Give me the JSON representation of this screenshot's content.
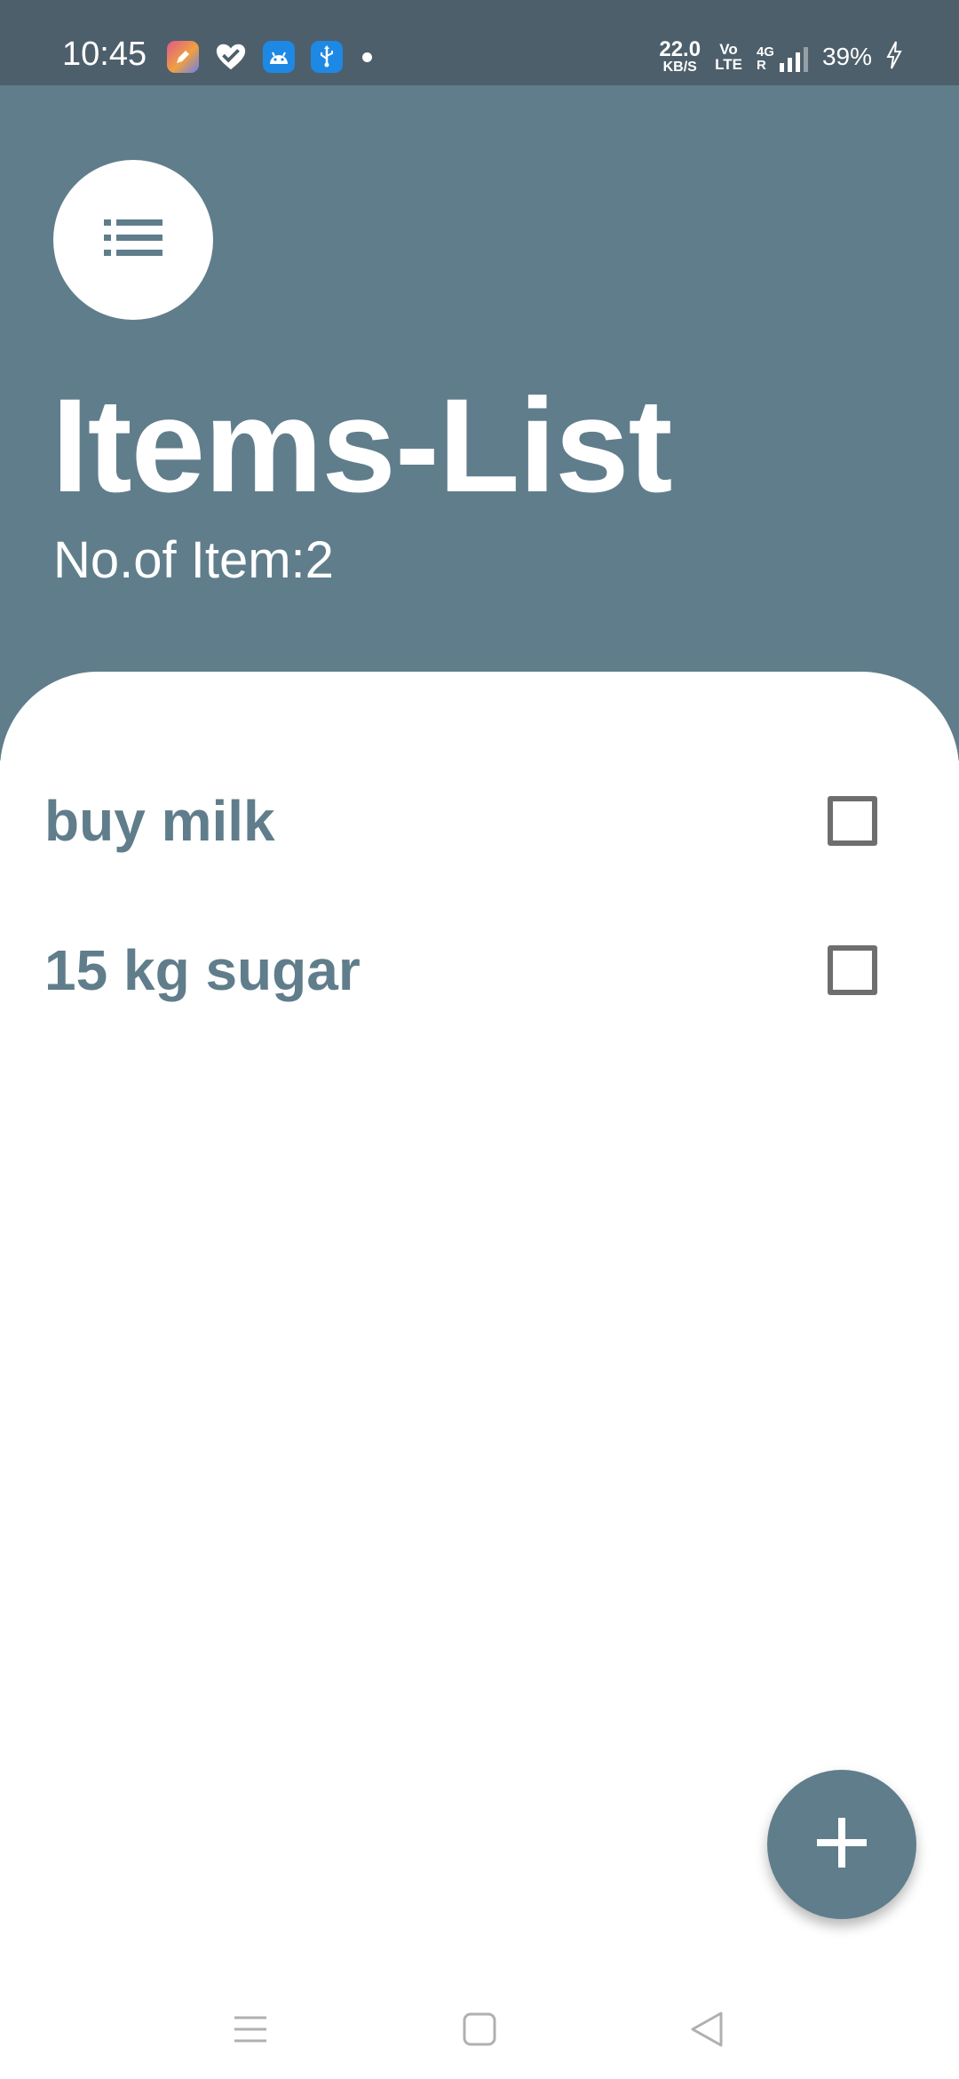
{
  "status_bar": {
    "time": "10:45",
    "speed_value": "22.0",
    "speed_unit": "KB/S",
    "volte_top": "Vo",
    "volte_bottom": "LTE",
    "network_top": "4G",
    "network_bottom": "R",
    "battery": "39%",
    "icons": [
      "pen-app-icon",
      "heart-check-icon",
      "android-icon",
      "usb-icon",
      "notification-dot",
      "charging-icon"
    ]
  },
  "header": {
    "menu_icon": "list-icon",
    "title": "Items-List",
    "count_text": "No.of Item:2"
  },
  "items": [
    {
      "label": "buy milk",
      "checked": false
    },
    {
      "label": "15 kg sugar",
      "checked": false
    }
  ],
  "fab": {
    "icon": "plus-icon"
  },
  "nav_bar": {
    "icons": [
      "recent-apps-icon",
      "home-icon",
      "back-icon"
    ]
  },
  "colors": {
    "primary": "#607d8b",
    "status_bar": "#4d5f6b",
    "checkbox_border": "#6e6e6e"
  }
}
